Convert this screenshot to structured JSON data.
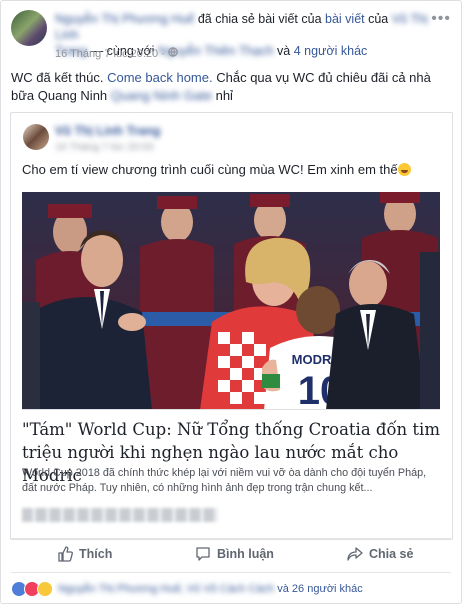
{
  "post": {
    "author": "Nguyễn Thị Phương Huế",
    "shared_text": "đã chia sẻ bài viết của",
    "shared_from": "Vũ Thị Linh",
    "shared_from_2": "Trang",
    "with_text": "— cùng với",
    "tagged_person": "Nguyễn Thiên Thạch",
    "and_text": "và",
    "others": "4 người khác",
    "timestamp": "16 Tháng 7 lúc 20:20",
    "separator": "·",
    "menu": "•••",
    "text_before": "WC đã kết thúc.",
    "text_link": "Come back home.",
    "text_mid": "Chắc qua vụ WC đủ chiêu đãi cả nhà bữa Quang Ninh",
    "text_blur": "Quang Ninh Gate",
    "text_end": "nhỉ"
  },
  "shared_post": {
    "author": "Vũ Thị Linh Trang",
    "timestamp": "16 Tháng 7 lúc 20:03",
    "text": "Cho em tí view chương trình cuối cùng mùa WC! Em xinh em thế",
    "emoji": "grinning-face-with-sweat-icon",
    "card": {
      "title": "\"Tám\" World Cup: Nữ Tổng thống Croatia đốn tim triệu người khi nghẹn ngào lau nước mắt cho Modric",
      "description": "World Cup 2018 đã chính thức khép lại với niềm vui vỡ òa dành cho đội tuyển Pháp, đất nước Pháp. Tuy nhiên, có những hình ảnh đẹp trong trận chung kết...",
      "jersey_name": "MODRIC",
      "jersey_number": "10"
    }
  },
  "actions": {
    "like": "Thích",
    "comment": "Bình luận",
    "share": "Chia sẻ"
  },
  "reactions": {
    "names": "Nguyễn Thị Phương Huế, Vũ Võ Cách Cách",
    "and_text": "và",
    "others": "26 người khác"
  },
  "colors": {
    "link": "#365899",
    "secondary_text": "#90949c",
    "action_text": "#606770",
    "border": "#dddfe2"
  }
}
